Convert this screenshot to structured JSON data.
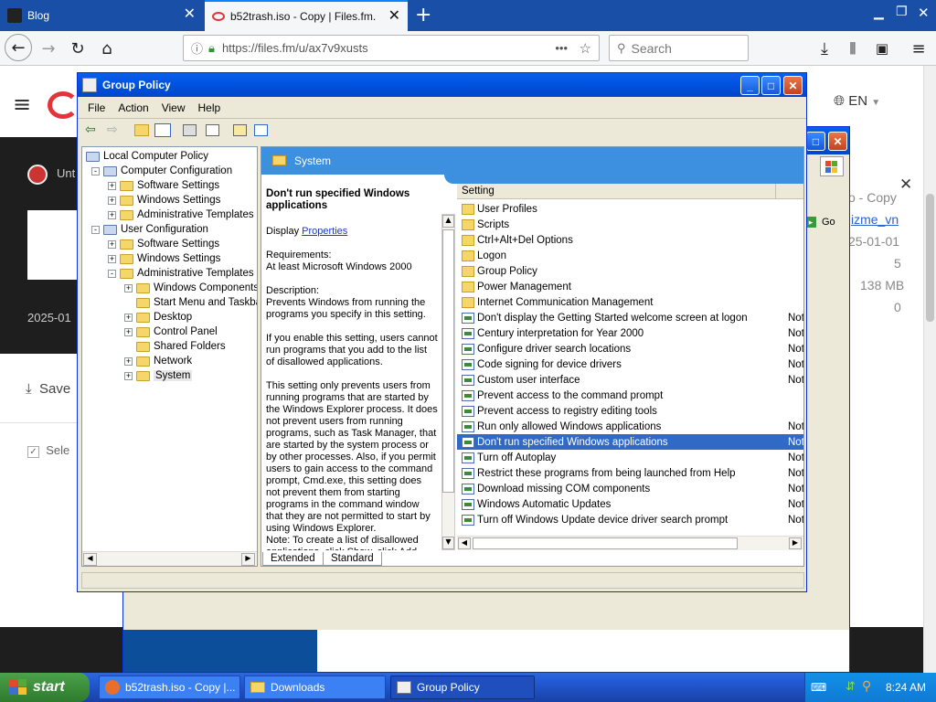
{
  "browser": {
    "tabs": [
      {
        "title": "Blog"
      },
      {
        "title": "b52trash.iso - Copy | Files.fm."
      }
    ],
    "url": "https://files.fm/u/ax7v9xusts",
    "search_placeholder": "Search",
    "url_more": "•••"
  },
  "website": {
    "lang": "EN",
    "file_title_partial": "Unt",
    "date_partial": "2025-01",
    "save_partial": "Save",
    "select_partial": "Sele",
    "side_panel": {
      "name_partial": "o - Copy",
      "link_partial": "izme_vn",
      "date_partial": "25-01-01",
      "value1": "5",
      "size": "138 MB",
      "value2": "0",
      "go_label": "Go"
    }
  },
  "gp_window": {
    "title": "Group Policy",
    "menu": [
      "File",
      "Action",
      "View",
      "Help"
    ],
    "tree": [
      {
        "label": "Local Computer Policy",
        "level": 0,
        "exp": ""
      },
      {
        "label": "Computer Configuration",
        "level": 1,
        "exp": "−"
      },
      {
        "label": "Software Settings",
        "level": 2,
        "exp": "+"
      },
      {
        "label": "Windows Settings",
        "level": 2,
        "exp": "+"
      },
      {
        "label": "Administrative Templates",
        "level": 2,
        "exp": "+"
      },
      {
        "label": "User Configuration",
        "level": 1,
        "exp": "−"
      },
      {
        "label": "Software Settings",
        "level": 2,
        "exp": "+"
      },
      {
        "label": "Windows Settings",
        "level": 2,
        "exp": "+"
      },
      {
        "label": "Administrative Templates",
        "level": 2,
        "exp": "−"
      },
      {
        "label": "Windows Components",
        "level": 3,
        "exp": "+"
      },
      {
        "label": "Start Menu and Taskba",
        "level": 3,
        "exp": ""
      },
      {
        "label": "Desktop",
        "level": 3,
        "exp": "+"
      },
      {
        "label": "Control Panel",
        "level": 3,
        "exp": "+"
      },
      {
        "label": "Shared Folders",
        "level": 3,
        "exp": ""
      },
      {
        "label": "Network",
        "level": 3,
        "exp": "+"
      },
      {
        "label": "System",
        "level": 3,
        "exp": "+"
      }
    ],
    "header_title": "System",
    "desc": {
      "title": "Don't run specified Windows applications",
      "display_label": "Display",
      "properties_link": "Properties",
      "requirements": "Requirements:\nAt least Microsoft Windows 2000",
      "body": "Description:\nPrevents Windows from running the programs you specify in this setting.\n\nIf you enable this setting, users cannot run programs that you add to the list of disallowed applications.\n\nThis setting only prevents users from running programs that are started by the Windows Explorer process. It does not prevent users from running programs, such as Task Manager, that are started by the system process or by other processes. Also, if you permit users to gain access to the command prompt, Cmd.exe, this setting does not prevent them from starting programs in the command window that they are not permitted to start by using Windows Explorer.\nNote: To create a list of disallowed applications, click Show, click Add"
    },
    "column_setting": "Setting",
    "settings": [
      {
        "name": "User Profiles",
        "type": "folder",
        "state": ""
      },
      {
        "name": "Scripts",
        "type": "folder",
        "state": ""
      },
      {
        "name": "Ctrl+Alt+Del Options",
        "type": "folder",
        "state": ""
      },
      {
        "name": "Logon",
        "type": "folder",
        "state": ""
      },
      {
        "name": "Group Policy",
        "type": "folder",
        "state": ""
      },
      {
        "name": "Power Management",
        "type": "folder",
        "state": ""
      },
      {
        "name": "Internet Communication Management",
        "type": "folder",
        "state": ""
      },
      {
        "name": "Don't display the Getting Started welcome screen at logon",
        "type": "policy",
        "state": "Not"
      },
      {
        "name": "Century interpretation for Year 2000",
        "type": "policy",
        "state": "Not"
      },
      {
        "name": "Configure driver search locations",
        "type": "policy",
        "state": "Not"
      },
      {
        "name": "Code signing for device drivers",
        "type": "policy",
        "state": "Not"
      },
      {
        "name": "Custom user interface",
        "type": "policy",
        "state": "Not"
      },
      {
        "name": "Prevent access to the command prompt",
        "type": "policy",
        "state": ""
      },
      {
        "name": "Prevent access to registry editing tools",
        "type": "policy",
        "state": ""
      },
      {
        "name": "Run only allowed Windows applications",
        "type": "policy",
        "state": "Not"
      },
      {
        "name": "Don't run specified Windows applications",
        "type": "policy",
        "state": "Not",
        "selected": true
      },
      {
        "name": "Turn off Autoplay",
        "type": "policy",
        "state": "Not"
      },
      {
        "name": "Restrict these programs from being launched from Help",
        "type": "policy",
        "state": "Not"
      },
      {
        "name": "Download missing COM components",
        "type": "policy",
        "state": "Not"
      },
      {
        "name": "Windows Automatic Updates",
        "type": "policy",
        "state": "Not"
      },
      {
        "name": "Turn off Windows Update device driver search prompt",
        "type": "policy",
        "state": "Not"
      }
    ],
    "tabs": [
      "Extended",
      "Standard"
    ]
  },
  "taskbar": {
    "start": "start",
    "items": [
      {
        "label": "b52trash.iso - Copy |..."
      },
      {
        "label": "Downloads"
      },
      {
        "label": "Group Policy"
      }
    ],
    "clock": "8:24 AM"
  }
}
